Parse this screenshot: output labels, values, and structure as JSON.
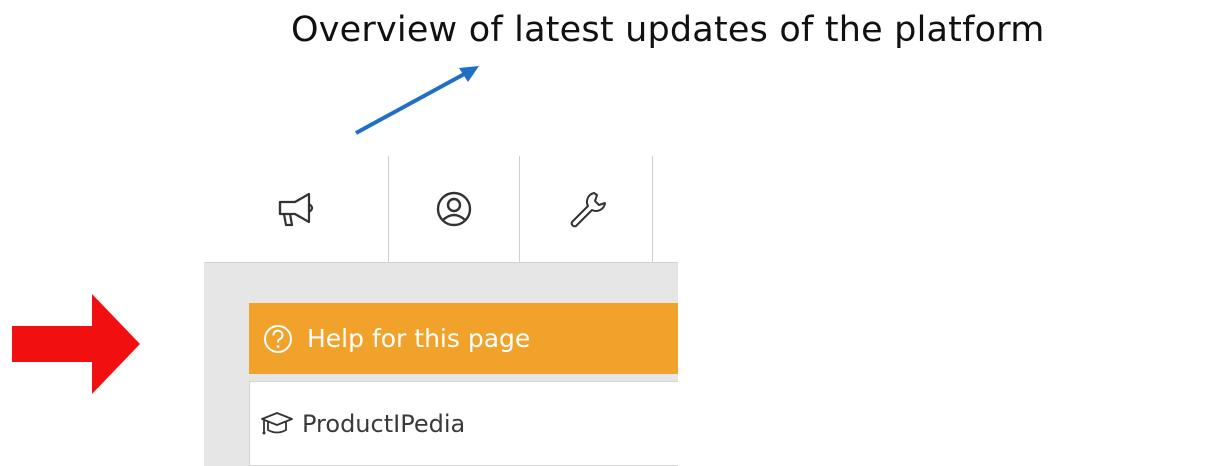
{
  "annotation": {
    "text": "Overview of latest updates of the platform",
    "arrow_color": "#1f6fc4"
  },
  "toolbar": {
    "icons": [
      {
        "name": "megaphone-icon"
      },
      {
        "name": "user-account-icon"
      },
      {
        "name": "wrench-icon"
      }
    ]
  },
  "help_bar": {
    "label": "Help for this page",
    "icon": "question-circle-icon",
    "color": "#f0a22a"
  },
  "nav_item": {
    "label": "ProductIPedia",
    "icon": "graduation-cap-icon"
  },
  "pointer": {
    "icon": "red-right-arrow",
    "color": "#f20f0f"
  }
}
